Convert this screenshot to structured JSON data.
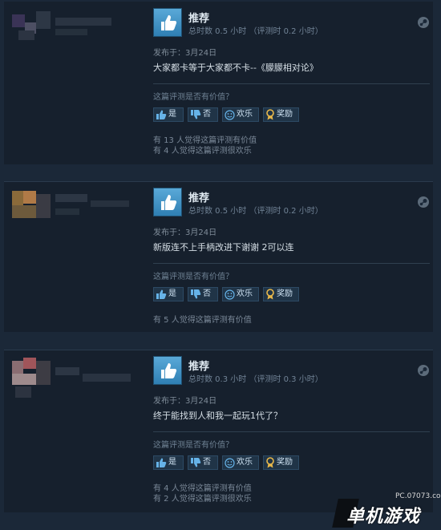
{
  "reviews": [
    {
      "title": "推荐",
      "hours": "总时数 0.5 小时 （评测时 0.2 小时）",
      "posted": "发布于：3月24日",
      "text": "大家都卡等于大家都不卡--《朦朦相对论》",
      "helpful_question": "这篇评测是否有价值？",
      "btn_yes": "是",
      "btn_no": "否",
      "btn_funny": "欢乐",
      "btn_award": "奖励",
      "stat1": "有 13 人觉得这篇评测有价值",
      "stat2": "有 4 人觉得这篇评测很欢乐"
    },
    {
      "title": "推荐",
      "hours": "总时数 0.5 小时 （评测时 0.2 小时）",
      "posted": "发布于：3月24日",
      "text": "新版连不上手柄改进下谢谢 2可以连",
      "helpful_question": "这篇评测是否有价值？",
      "btn_yes": "是",
      "btn_no": "否",
      "btn_funny": "欢乐",
      "btn_award": "奖励",
      "stat1": "有 5 人觉得这篇评测有价值",
      "stat2": ""
    },
    {
      "title": "推荐",
      "hours": "总时数 0.3 小时 （评测时 0.3 小时）",
      "posted": "发布于：3月24日",
      "text": "终于能找到人和我一起玩1代了？",
      "helpful_question": "这篇评测是否有价值？",
      "btn_yes": "是",
      "btn_no": "否",
      "btn_funny": "欢乐",
      "btn_award": "奖励",
      "stat1": "有 4 人觉得这篇评测有价值",
      "stat2": "有 2 人觉得这篇评测很欢乐"
    }
  ],
  "watermark": {
    "site": "PC.07073.com",
    "title": "单机游戏"
  },
  "colors": {
    "background": "#1b2838",
    "panel": "#16202d",
    "accent_thumb": "#5aa9d8",
    "award": "#e8b84a"
  }
}
